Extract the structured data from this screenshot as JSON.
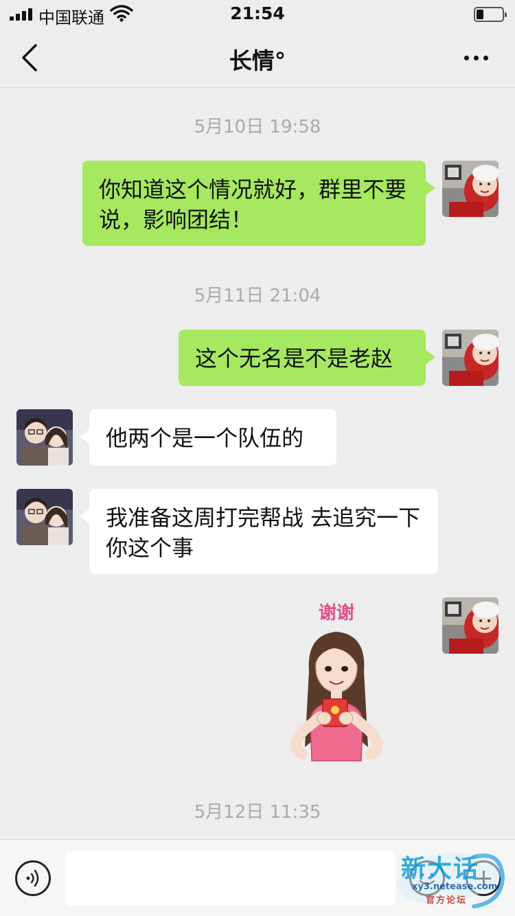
{
  "status_bar": {
    "carrier": "中国联通",
    "time": "21:54"
  },
  "nav": {
    "title": "长情°"
  },
  "messages": {
    "ts1": "5月10日 19:58",
    "m1": "你知道这个情况就好，群里不要说，影响团结！",
    "ts2": "5月11日 21:04",
    "m2": "这个无名是不是老赵",
    "m3": "他两个是一个队伍的",
    "m4": "我准备这周打完帮战 去追究一下你这个事",
    "sticker_caption": "谢谢",
    "ts3": "5月12日 11:35"
  },
  "input": {
    "value": "",
    "placeholder": ""
  },
  "watermark": {
    "title": "新大话",
    "url": "xy3.netease.com",
    "sub": "官方论坛"
  },
  "colors": {
    "outgoing_bubble": "#a6e860",
    "incoming_bubble": "#ffffff",
    "background": "#ededed",
    "timestamp_text": "#aaaaaa"
  },
  "icons": [
    "signal-icon",
    "wifi-icon",
    "battery-icon",
    "back-icon",
    "more-icon",
    "voice-icon",
    "emoji-icon",
    "plus-icon"
  ]
}
